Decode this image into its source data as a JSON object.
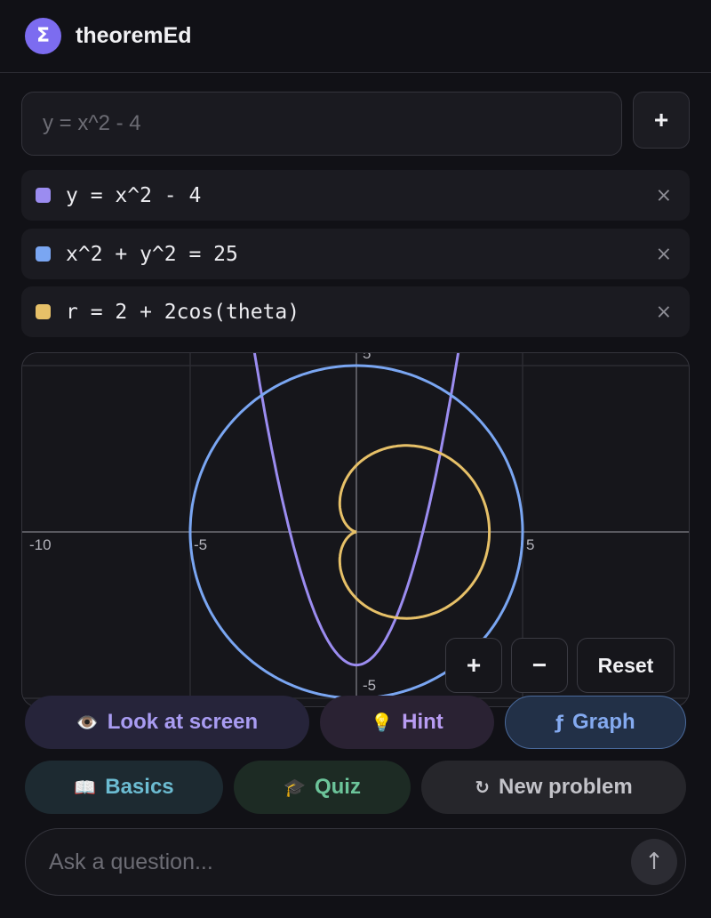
{
  "app": {
    "logo_glyph": "Σ",
    "title": "theoremEd"
  },
  "equation_input": {
    "placeholder": "y = x^2 - 4",
    "value": ""
  },
  "add_button": {
    "label": "+"
  },
  "equations": [
    {
      "text": "y = x^2 - 4",
      "color": "#9b8cf0",
      "remove": "×"
    },
    {
      "text": "x^2 + y^2 = 25",
      "color": "#7aa6f2",
      "remove": "×"
    },
    {
      "text": "r = 2 + 2cos(theta)",
      "color": "#e6c068",
      "remove": "×"
    }
  ],
  "graph": {
    "tick_labels": {
      "x_neg10": "-10",
      "x_neg5": "-5",
      "x_5": "5",
      "y_5": "5",
      "y_neg5": "-5"
    },
    "zoom_in": "+",
    "zoom_out": "−",
    "reset": "Reset"
  },
  "chips": {
    "look": {
      "icon": "👁️",
      "label": "Look at screen"
    },
    "hint": {
      "icon": "💡",
      "label": "Hint"
    },
    "graph": {
      "icon": "ƒ",
      "label": "Graph"
    },
    "basics": {
      "icon": "📖",
      "label": "Basics"
    },
    "quiz": {
      "icon": "🎓",
      "label": "Quiz"
    },
    "new_problem": {
      "icon": "↻",
      "label": "New problem"
    }
  },
  "ask": {
    "placeholder": "Ask a question...",
    "send_icon": "↑"
  },
  "colors": {
    "background": "#111116",
    "accent": "#7c6cf0"
  }
}
